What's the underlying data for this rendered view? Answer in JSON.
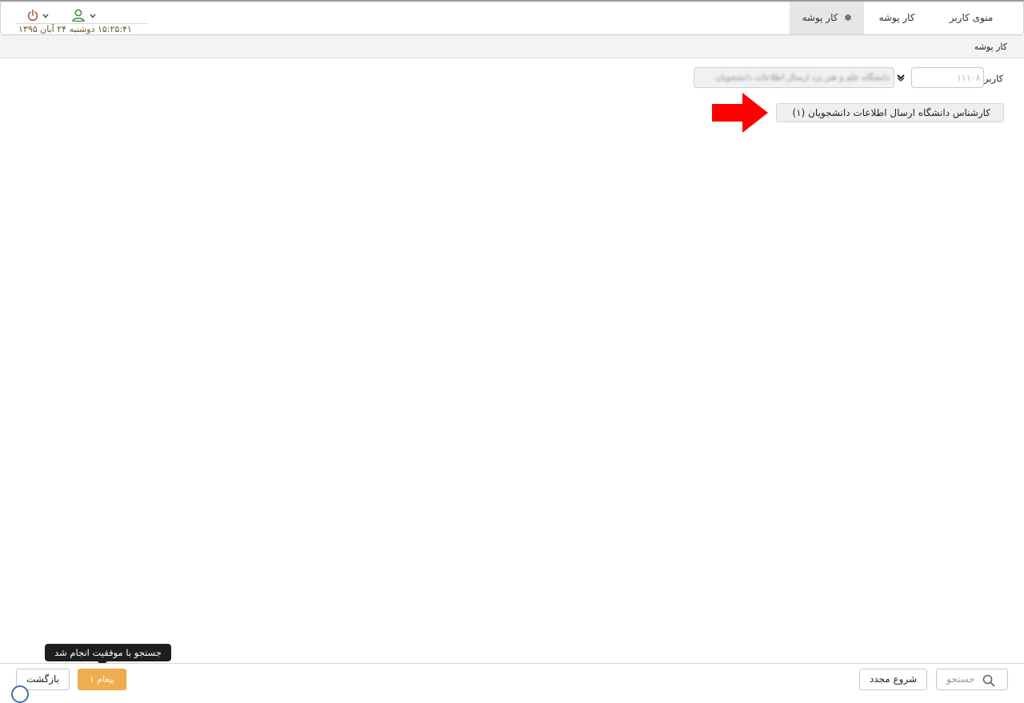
{
  "header": {
    "tabs": [
      {
        "label": "منوی کاربر"
      },
      {
        "label": "کار پوشه"
      },
      {
        "label": "کار پوشه"
      }
    ],
    "datetime": "۱۵:۲۵:۴۱ دوشنبه ۲۴ آبان ۱۳۹۵",
    "icons": {
      "power": "power-icon",
      "user": "user-icon",
      "tab_marker": "puzzle-icon"
    },
    "colors": {
      "power": "#a85a4a",
      "user": "#3e8a3a"
    }
  },
  "breadcrumb": "کار پوشه",
  "form": {
    "user_label": "کاربر",
    "user_code": "۱۱۱۰۸",
    "unit_value": "دانشگاه علم و هنر یزد ارسال اطلاعات دانشجویان"
  },
  "role_button": {
    "label": "کارشناس دانشگاه ارسال اطلاعات دانشجویان (۱)"
  },
  "annotation": {
    "arrow_color": "#ff0000"
  },
  "footer": {
    "back_label": "بازگشت",
    "messages_label": "۱ پیغام",
    "restart_label": "شروع مجدد",
    "search_label": "جستجو",
    "tooltip": "جستجو با موفقیت انجام شد",
    "messages_color": "#f0ad4e"
  }
}
